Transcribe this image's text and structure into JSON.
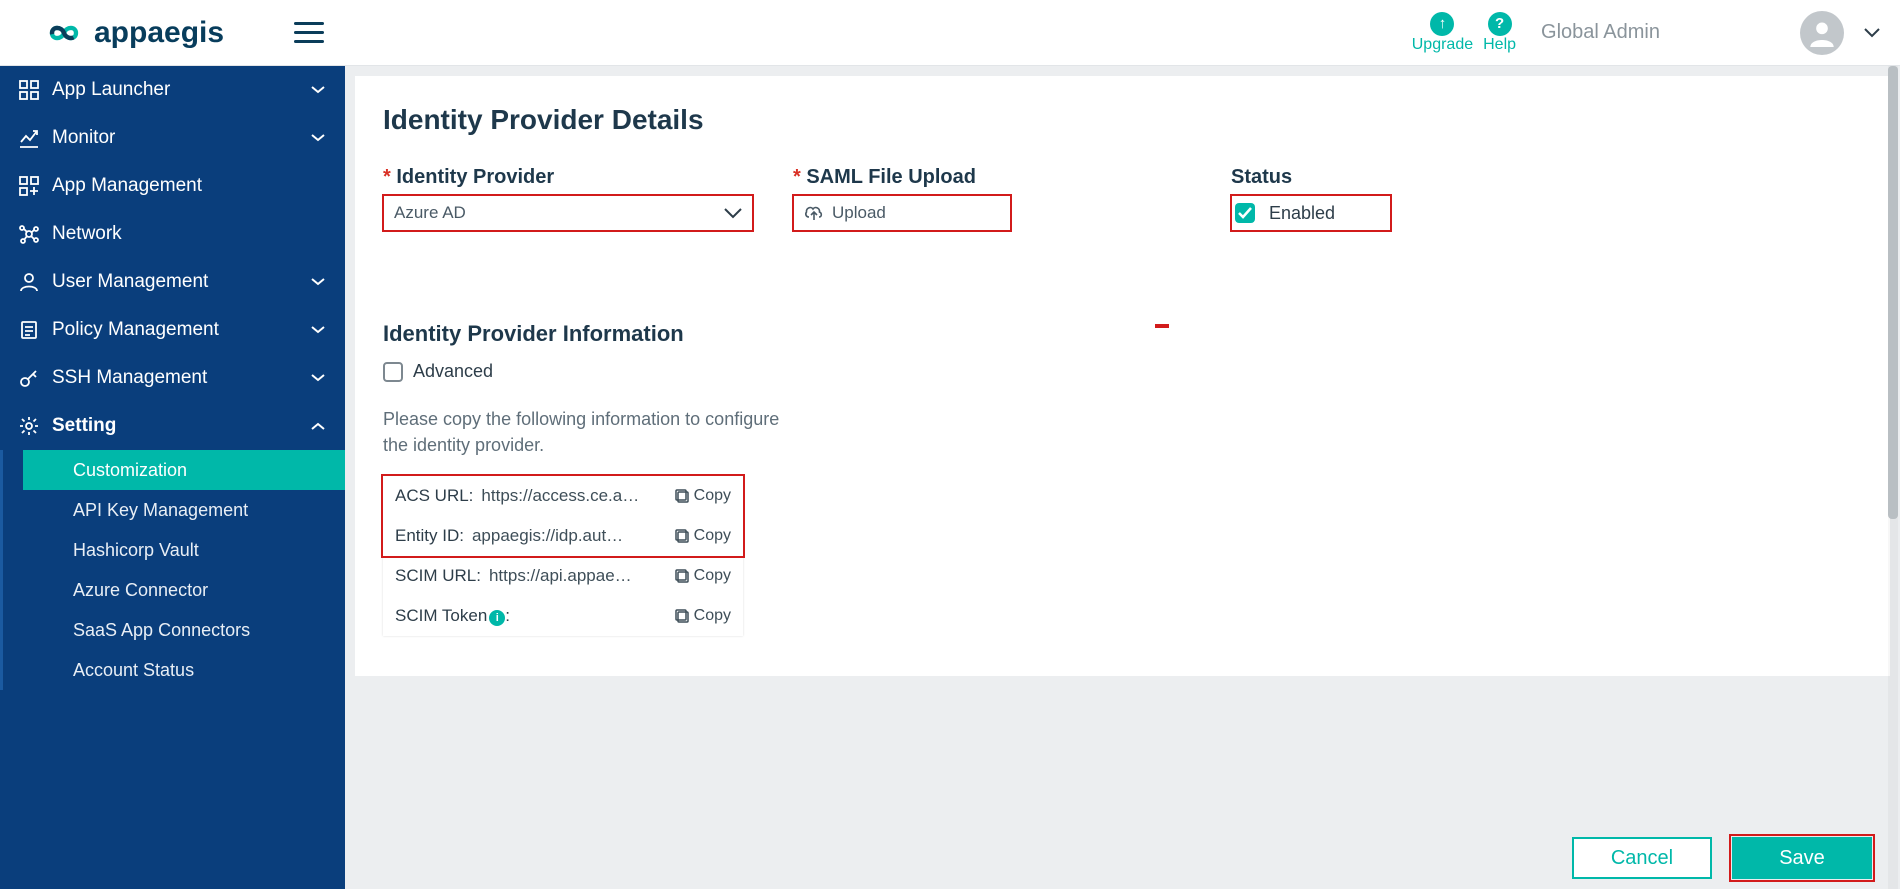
{
  "brand": {
    "name": "appaegis"
  },
  "topbar": {
    "upgrade": "Upgrade",
    "help": "Help",
    "role": "Global Admin"
  },
  "sidebar": {
    "items": [
      {
        "label": "App Launcher",
        "expandable": true
      },
      {
        "label": "Monitor",
        "expandable": true
      },
      {
        "label": "App Management",
        "expandable": false
      },
      {
        "label": "Network",
        "expandable": false
      },
      {
        "label": "User Management",
        "expandable": true
      },
      {
        "label": "Policy Management",
        "expandable": true
      },
      {
        "label": "SSH Management",
        "expandable": true
      },
      {
        "label": "Setting",
        "expandable": true,
        "open": true,
        "children": [
          "Customization",
          "API Key Management",
          "Hashicorp Vault",
          "Azure Connector",
          "SaaS App Connectors",
          "Account Status"
        ]
      }
    ]
  },
  "page": {
    "title": "Identity Provider Details",
    "idp_label": "Identity Provider",
    "idp_value": "Azure AD",
    "saml_label": "SAML File Upload",
    "saml_button": "Upload",
    "status_label": "Status",
    "status_value": "Enabled",
    "info_title": "Identity Provider Information",
    "advanced_label": "Advanced",
    "instruction": "Please copy the following information to configure the identity provider.",
    "rows": [
      {
        "k": "ACS URL:",
        "v": "https://access.ce.a…"
      },
      {
        "k": "Entity ID:",
        "v": "appaegis://idp.aut…"
      },
      {
        "k": "SCIM URL:",
        "v": "https://api.appae…"
      },
      {
        "k": "SCIM Token",
        "v": "",
        "help": true,
        "colon": ":"
      }
    ],
    "copy_label": "Copy",
    "cancel": "Cancel",
    "save": "Save"
  }
}
